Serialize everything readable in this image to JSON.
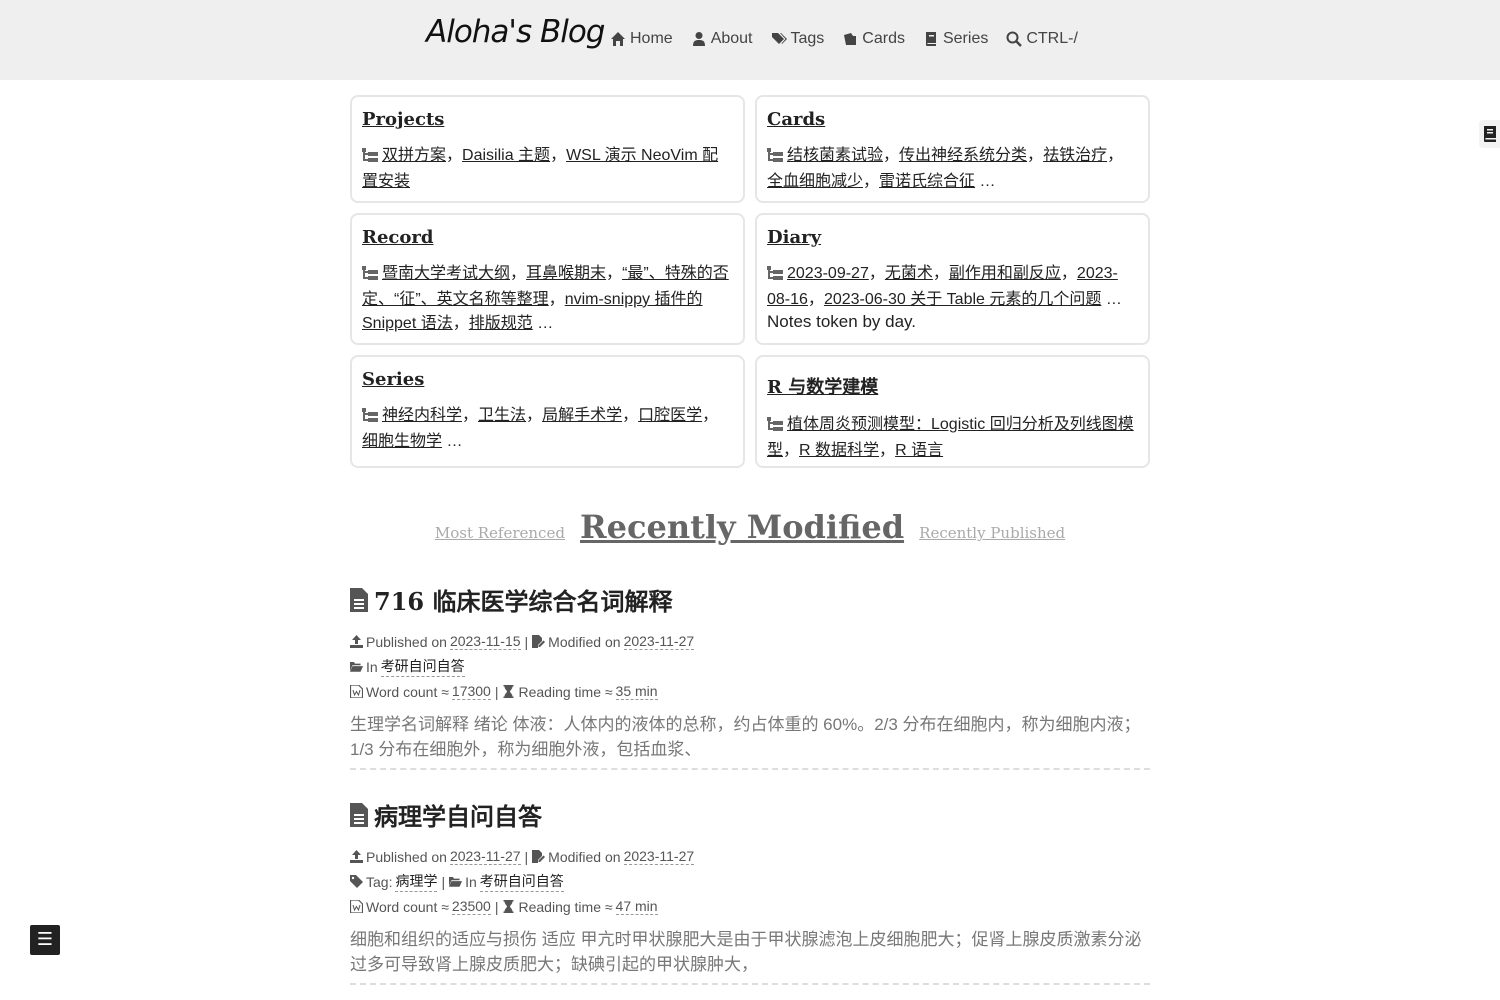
{
  "header": {
    "logo": "Aloha's Blog",
    "nav": [
      {
        "label": "Home",
        "icon": "home-icon"
      },
      {
        "label": "About",
        "icon": "user-icon"
      },
      {
        "label": "Tags",
        "icon": "tags-icon"
      },
      {
        "label": "Cards",
        "icon": "cards-icon"
      },
      {
        "label": "Series",
        "icon": "book-icon"
      },
      {
        "label": "CTRL-/",
        "icon": "search-icon"
      }
    ]
  },
  "cards": [
    {
      "title": "Projects",
      "links": [
        "双拼方案",
        "Daisilia 主题",
        "WSL 演示 NeoVim 配置安装"
      ],
      "more": "",
      "note": ""
    },
    {
      "title": "Cards",
      "links": [
        "结核菌素试验",
        "传出神经系统分类",
        "祛铁治疗",
        "全血细胞减少",
        "雷诺氏综合征"
      ],
      "more": "…",
      "note": ""
    },
    {
      "title": "Record",
      "links": [
        "暨南大学考试大纲",
        "耳鼻喉期末",
        "“最”、特殊的否定、“征”、英文名称等整理",
        "nvim-snippy 插件的 Snippet 语法",
        "排版规范"
      ],
      "more": "…",
      "note": ""
    },
    {
      "title": "Diary",
      "links": [
        "2023-09-27",
        "无菌术",
        "副作用和副反应",
        "2023-08-16",
        "2023-06-30 关于 Table 元素的几个问题"
      ],
      "more": "…",
      "note": "Notes token by day."
    },
    {
      "title": "Series",
      "links": [
        "神经内科学",
        "卫生法",
        "局解手术学",
        "口腔医学",
        "细胞生物学"
      ],
      "more": "…",
      "note": ""
    },
    {
      "title": "R 与数学建模",
      "links": [
        "植体周炎预测模型：Logistic 回归分析及列线图模型",
        "R 数据科学",
        "R 语言"
      ],
      "more": "",
      "note": ""
    }
  ],
  "tabs": {
    "left": "Most Referenced",
    "active": "Recently Modified",
    "right": "Recently Published"
  },
  "posts": [
    {
      "title": "716 临床医学综合名词解释",
      "published_label": "Published on",
      "published": "2023-11-15",
      "modified_label": "Modified on",
      "modified": "2023-11-27",
      "tag_label": "",
      "tag": "",
      "in_label": "In",
      "category": "考研自问自答",
      "wc_label": "Word count ≈",
      "word_count": "17300",
      "rt_label": "Reading time ≈",
      "reading_time": "35 min",
      "excerpt": "生理学名词解释 绪论 体液：人体内的液体的总称，约占体重的 60%。2/3 分布在细胞内，称为细胞内液；1/3 分布在细胞外，称为细胞外液，包括血浆、"
    },
    {
      "title": "病理学自问自答",
      "published_label": "Published on",
      "published": "2023-11-27",
      "modified_label": "Modified on",
      "modified": "2023-11-27",
      "tag_label": "Tag:",
      "tag": "病理学",
      "in_label": "In",
      "category": "考研自问自答",
      "wc_label": "Word count ≈",
      "word_count": "23500",
      "rt_label": "Reading time ≈",
      "reading_time": "47 min",
      "excerpt": "细胞和组织的适应与损伤 适应 甲亢时甲状腺肥大是由于甲状腺滤泡上皮细胞肥大；促肾上腺皮质激素分泌过多可导致肾上腺皮质肥大；缺碘引起的甲状腺肿大，"
    }
  ]
}
